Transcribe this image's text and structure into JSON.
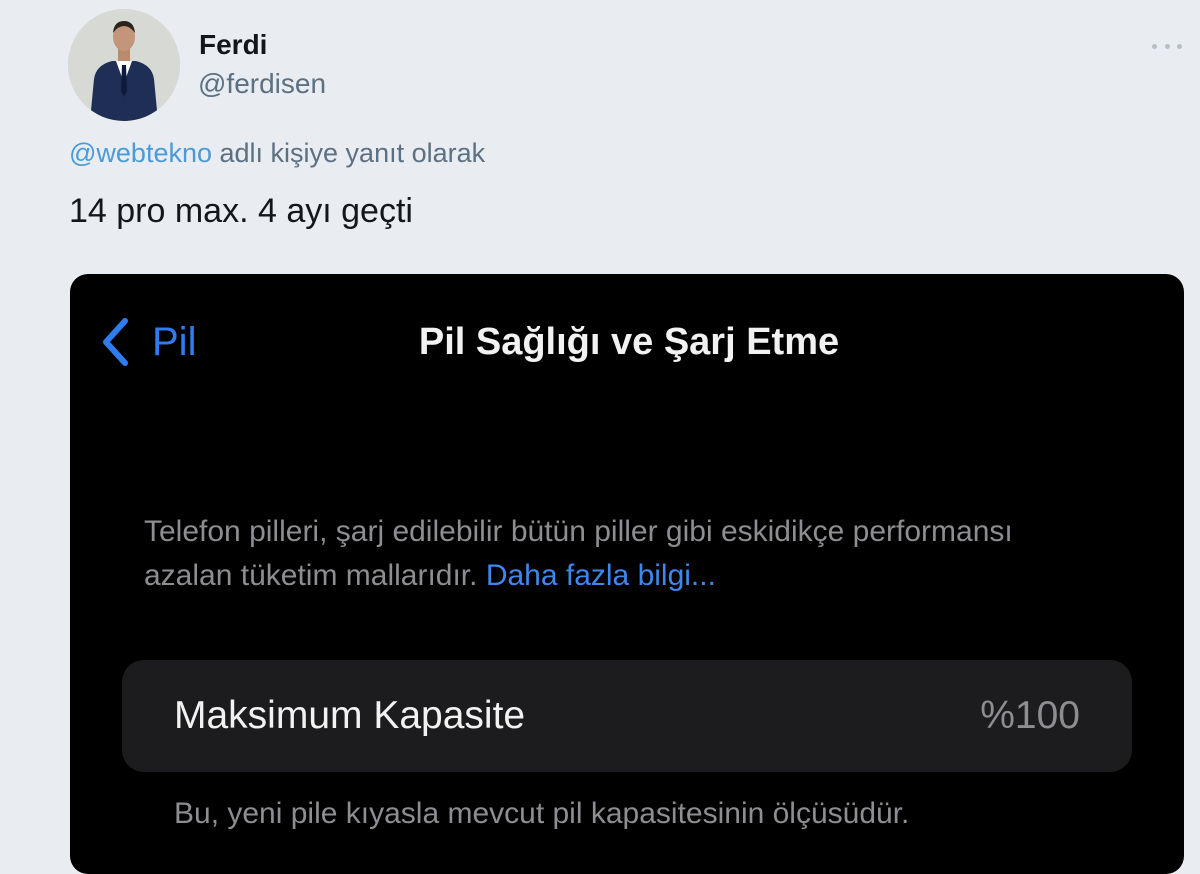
{
  "tweet": {
    "author": {
      "display_name": "Ferdi",
      "handle": "@ferdisen"
    },
    "more_icon": "more-horizontal-icon",
    "reply_context": {
      "mention": "@webtekno",
      "suffix": " adlı kişiye yanıt olarak"
    },
    "text": "14 pro max. 4 ayı geçti"
  },
  "screenshot": {
    "back_icon": "chevron-left-icon",
    "back_label": "Pil",
    "title": "Pil Sağlığı ve Şarj Etme",
    "description_text": "Telefon pilleri, şarj edilebilir bütün piller gibi eskidikçe performansı azalan tüketim mallarıdır. ",
    "description_link": "Daha fazla bilgi...",
    "capacity": {
      "label": "Maksimum Kapasite",
      "value": "%100"
    },
    "footnote": "Bu, yeni pile kıyasla mevcut pil kapasitesinin ölçüsüdür."
  },
  "colors": {
    "page_background": "#e9ecf0",
    "mention_blue": "#4a9bd8",
    "ios_blue": "#2f7cf0",
    "ios_background": "#000000",
    "ios_cell": "#1c1c1e"
  }
}
